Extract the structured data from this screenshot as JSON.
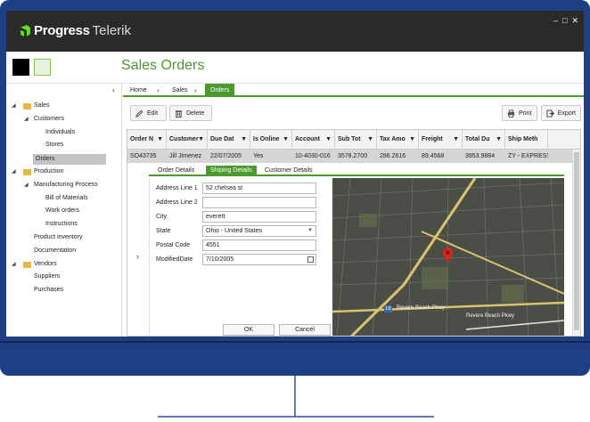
{
  "window": {
    "brand_bold": "Progress",
    "brand_light": "Telerik",
    "controls": [
      "–",
      "□",
      "✕"
    ]
  },
  "header": {
    "title": "Sales Orders"
  },
  "sidebar": {
    "collapse_glyph": "‹",
    "items": [
      {
        "label": "Sales",
        "level": 0,
        "expanded": true,
        "folder": true
      },
      {
        "label": "Customers",
        "level": 1,
        "expanded": true,
        "folder": false
      },
      {
        "label": "Individuals",
        "level": 2,
        "expanded": false,
        "folder": false
      },
      {
        "label": "Stores",
        "level": 2,
        "expanded": false,
        "folder": false
      },
      {
        "label": "Orders",
        "level": 1,
        "expanded": false,
        "folder": false,
        "selected": true
      },
      {
        "label": "Production",
        "level": 0,
        "expanded": true,
        "folder": true
      },
      {
        "label": "Manufacturing Process",
        "level": 1,
        "expanded": true,
        "folder": false
      },
      {
        "label": "Bill of Materials",
        "level": 2,
        "expanded": false,
        "folder": false
      },
      {
        "label": "Work orders",
        "level": 2,
        "expanded": false,
        "folder": false
      },
      {
        "label": "Instructions",
        "level": 2,
        "expanded": false,
        "folder": false
      },
      {
        "label": "Product inventory",
        "level": 1,
        "expanded": false,
        "folder": false
      },
      {
        "label": "Documentation",
        "level": 1,
        "expanded": false,
        "folder": false
      },
      {
        "label": "Vendors",
        "level": 0,
        "expanded": true,
        "folder": true
      },
      {
        "label": "Suppliers",
        "level": 1,
        "expanded": false,
        "folder": false
      },
      {
        "label": "Purchases",
        "level": 1,
        "expanded": false,
        "folder": false
      }
    ]
  },
  "breadcrumb": {
    "items": [
      "Home",
      "Sales",
      "Orders"
    ]
  },
  "toolbar": {
    "edit_label": "Edit",
    "delete_label": "Delete",
    "print_label": "Print",
    "export_label": "Export"
  },
  "grid": {
    "columns": [
      "Order N",
      "Customer",
      "Due Dat",
      "Is Online",
      "Account",
      "Sub Tot",
      "Tax Amo",
      "Freight",
      "Total Du",
      "Ship Meth"
    ],
    "row": [
      "SO43735",
      "Jill Jimenez",
      "22/07/2005",
      "Yes",
      "10-4030-016",
      "3578.2700",
      "286.2616",
      "89.4568",
      "3953.9884",
      "ZY - EXPRESS"
    ]
  },
  "details": {
    "tabs": [
      "Order Details",
      "Shiping Details",
      "Customer Details"
    ],
    "active_tab": 1,
    "fields": {
      "address1_label": "Address Line 1",
      "address1_value": "52 chelsea st",
      "address2_label": "Address Line 2",
      "address2_value": "",
      "city_label": "City",
      "city_value": "everett",
      "state_label": "State",
      "state_value": "Ohio - United States",
      "postal_label": "Postal Code",
      "postal_value": "4551",
      "modified_label": "ModifiedDate",
      "modified_value": "7/10/2005"
    },
    "ok_label": "OK",
    "cancel_label": "Cancel",
    "expand_glyph": "›"
  },
  "map": {
    "labels": [
      "Revere Beach Pkwy",
      "Revere Beach Pkwy"
    ],
    "route_shield": "16",
    "pin_color": "#d9261c"
  },
  "colors": {
    "accent": "#4a9a2c",
    "device": "#1f3f85",
    "titlebar": "#2a2a2a"
  }
}
